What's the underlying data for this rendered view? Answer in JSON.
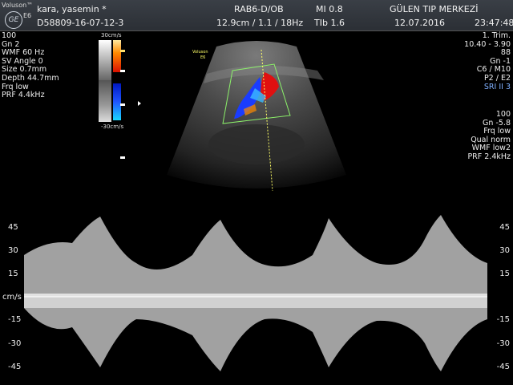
{
  "header": {
    "brand_small": "Voluson™",
    "logo_text": "GE",
    "model": "E6",
    "patient_name": "kara, yasemin  *",
    "patient_id": "D58809-16-07-12-3",
    "probe": "RAB6-D/OB",
    "depth_info": "12.9cm / 1.1 / 18Hz",
    "mi": "MI  0.8",
    "tib": "TIb  1.6",
    "institution": "GÜLEN TIP MERKEZİ",
    "date": "12.07.2016",
    "time": "23:47:48"
  },
  "left_params": [
    "100",
    "Gn  2",
    "WMF 60 Hz",
    "SV Angle  0",
    "Size  0.7mm",
    "Depth 44.7mm",
    "Frq low",
    "PRF  4.4kHz"
  ],
  "right_params_top": [
    "1. Trim.",
    "10.40 - 3.90",
    "88",
    "Gn  -1",
    "C6 / M10",
    "P2 / E2"
  ],
  "right_sri": "SRI II 3",
  "right_params_bottom": [
    "100",
    "Gn  -5.8",
    "Frq low",
    "Qual norm",
    "WMF low2",
    "PRF  2.4kHz"
  ],
  "colorbar": {
    "top_label": "30cm/s",
    "bottom_label": "-30cm/s"
  },
  "image_overlay": {
    "brand": "Voluson",
    "model": "E6"
  },
  "spectrum": {
    "unit_label": "cm/s",
    "right_scale": [
      "45",
      "30",
      "15",
      "-15",
      "-30",
      "-45"
    ],
    "left_scale": [
      "45",
      "30",
      "15",
      "-15",
      "-30",
      "-45"
    ]
  },
  "colors": {
    "flow_red": "#e01010",
    "flow_blue": "#1a3cff",
    "box": "#8cf26a",
    "line": "#ffff66"
  }
}
